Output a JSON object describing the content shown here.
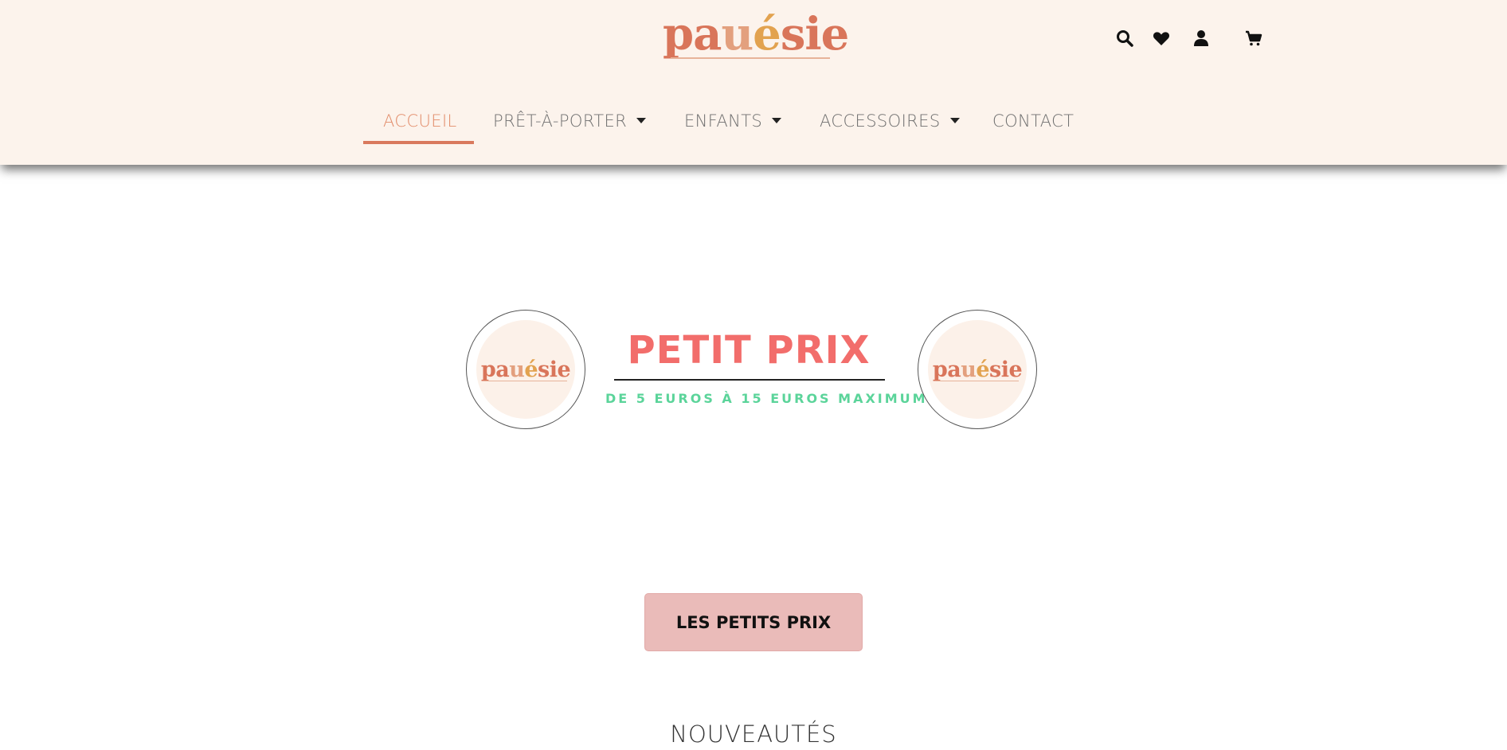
{
  "brand": {
    "logo_part1": "pa",
    "logo_part2": "u",
    "logo_part3": "é",
    "logo_part4": "sie",
    "colors": {
      "primary": "#d9755a",
      "accent_pink": "#f26d6b",
      "accent_green": "#5bd49a",
      "header_bg": "#fcf3ec",
      "button_bg": "#eabbb9"
    }
  },
  "header_icons": [
    "search-icon",
    "heart-icon",
    "user-icon",
    "cart-icon"
  ],
  "nav": {
    "items": [
      {
        "label": "ACCUEIL",
        "active": true,
        "has_dropdown": false
      },
      {
        "label": "PRÊT-À-PORTER",
        "active": false,
        "has_dropdown": true
      },
      {
        "label": "ENFANTS",
        "active": false,
        "has_dropdown": true
      },
      {
        "label": "ACCESSOIRES",
        "active": false,
        "has_dropdown": true
      },
      {
        "label": "CONTACT",
        "active": false,
        "has_dropdown": false
      }
    ]
  },
  "promo": {
    "title": "PETIT PRIX",
    "subtitle": "DE 5 EUROS À 15 EUROS MAXIMUM!"
  },
  "cta": {
    "label": "LES PETITS PRIX"
  },
  "section": {
    "title": "NOUVEAUTÉS"
  }
}
